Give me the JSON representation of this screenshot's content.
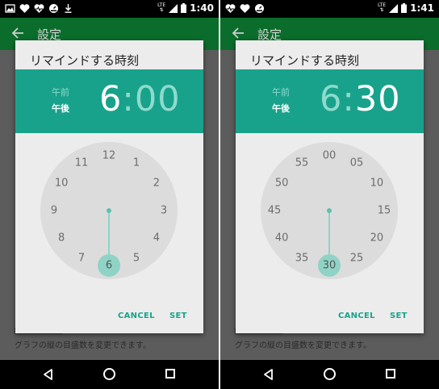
{
  "colors": {
    "accent": "#19a28b",
    "appbar": "#0b6d2c"
  },
  "panels": [
    {
      "status_time": "1:40",
      "status_network": "LTE",
      "appbar_title": "設定",
      "settings_description": "グラフの縦の目盛数を変更できます。",
      "dialog": {
        "title": "リマインドする時刻",
        "am_label": "午前",
        "pm_label": "午後",
        "hour": "6",
        "colon": ":",
        "minute": "00",
        "mode": "hours",
        "dial_labels": [
          "12",
          "1",
          "2",
          "3",
          "4",
          "5",
          "6",
          "7",
          "8",
          "9",
          "10",
          "11"
        ],
        "selected": "6",
        "cancel_label": "CANCEL",
        "set_label": "SET"
      }
    },
    {
      "status_time": "1:41",
      "status_network": "LTE",
      "appbar_title": "設定",
      "settings_description": "グラフの縦の目盛数を変更できます。",
      "dialog": {
        "title": "リマインドする時刻",
        "am_label": "午前",
        "pm_label": "午後",
        "hour": "6",
        "colon": ":",
        "minute": "30",
        "mode": "minutes",
        "dial_labels": [
          "00",
          "05",
          "10",
          "15",
          "20",
          "25",
          "30",
          "35",
          "40",
          "45",
          "50",
          "55"
        ],
        "selected": "30",
        "cancel_label": "CANCEL",
        "set_label": "SET"
      }
    }
  ]
}
